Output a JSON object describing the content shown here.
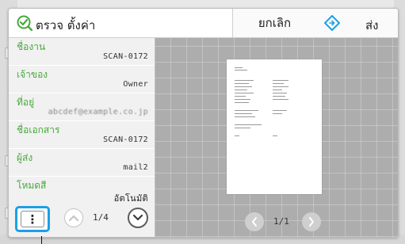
{
  "header": {
    "title": "ตรวจ ตั้งค่า",
    "cancel_label": "ยกเลิก",
    "send_label": "ส่ง"
  },
  "fields": [
    {
      "label": "ชื่องาน",
      "value": "SCAN-0172"
    },
    {
      "label": "เจ้าของ",
      "value": "Owner"
    },
    {
      "label": "ที่อยู่",
      "value": "abcdef@example.co.jp"
    },
    {
      "label": "ชื่อเอกสาร",
      "value": "SCAN-0172"
    },
    {
      "label": "ผู้ส่ง",
      "value": "mail2"
    },
    {
      "label": "โหมดสี",
      "value": "อัตโนมัติ"
    }
  ],
  "list_pager": {
    "text": "1/4"
  },
  "preview_pager": {
    "text": "1/1"
  },
  "colors": {
    "accent_green": "#48a93d",
    "highlight_blue": "#1aa0e6",
    "preview_bg": "#adadad"
  },
  "icons": {
    "title": "checkmark-search-icon",
    "send": "diamond-arrow-icon",
    "menu": "vertical-ellipsis-icon",
    "up": "chevron-up-icon",
    "down": "chevron-down-icon",
    "preview_prev": "chevron-left-icon",
    "preview_next": "chevron-right-icon"
  }
}
